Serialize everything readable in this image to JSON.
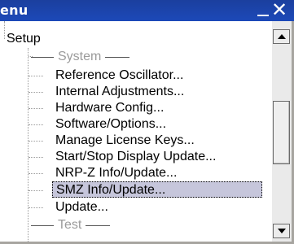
{
  "window": {
    "title": "enu",
    "minimize_icon": "minimize-icon",
    "close_glyph": "✕"
  },
  "tree": {
    "root_label": "Setup",
    "sections": [
      {
        "label": "System",
        "items": [
          {
            "label": "Reference Oscillator...",
            "selected": false
          },
          {
            "label": "Internal Adjustments...",
            "selected": false
          },
          {
            "label": "Hardware Config...",
            "selected": false
          },
          {
            "label": "Software/Options...",
            "selected": false
          },
          {
            "label": "Manage License Keys...",
            "selected": false
          },
          {
            "label": "Start/Stop Display Update...",
            "selected": false
          },
          {
            "label": "NRP-Z Info/Update...",
            "selected": false
          },
          {
            "label": "SMZ Info/Update...",
            "selected": true
          },
          {
            "label": "Update...",
            "selected": false
          }
        ]
      },
      {
        "label": "Test",
        "items": []
      }
    ]
  },
  "colors": {
    "titlebar": "#1c49b8",
    "selection": "#c6c6db",
    "section_text": "#9b9b9b"
  }
}
